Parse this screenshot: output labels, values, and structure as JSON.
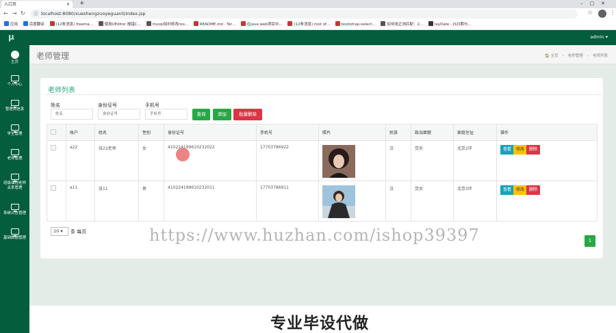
{
  "browser": {
    "tab_title": "入口页",
    "url": "localhost:8080/xueshengzuoyeguanli/index.jsp",
    "bookmarks": [
      "应用",
      "百度翻译",
      "(12条消息) freema...",
      "使用UEditor 报错C...",
      "mysql如何修改roo...",
      "README.md · Ter...",
      "在java web项目中...",
      "(12条消息) root of...",
      "bootstrap-select...",
      "如何用正则匹配：2...",
      "layDate - JS日期与..."
    ]
  },
  "app": {
    "logo": "μ",
    "user": "admin ▾",
    "sidebar": [
      {
        "label": "主页",
        "icon": "dashboard-icon"
      },
      {
        "label": "个人中心",
        "icon": "monitor-icon"
      },
      {
        "label": "管理员信息",
        "icon": "monitor-icon"
      },
      {
        "label": "学生管理",
        "icon": "monitor-icon"
      },
      {
        "label": "老师管理",
        "icon": "monitor-icon"
      },
      {
        "label": "班级课程老师",
        "label2": "关系管理",
        "icon": "monitor-icon"
      },
      {
        "label": "系统公告管理",
        "icon": "monitor-icon"
      },
      {
        "label": "基础数据管理",
        "icon": "monitor-icon"
      }
    ],
    "page_title": "老师管理",
    "breadcrumb": [
      "🏠 主页",
      "›",
      "老师管理",
      "›",
      "老师列表"
    ]
  },
  "card": {
    "title": "老师列表",
    "filters": [
      {
        "label": "姓名",
        "placeholder": "姓名"
      },
      {
        "label": "身份证号",
        "placeholder": "身份证号"
      },
      {
        "label": "手机号",
        "placeholder": "手机号"
      }
    ],
    "buttons": {
      "search": "查询",
      "add": "添加",
      "batch_delete": "批量删除"
    },
    "columns": [
      "",
      "账户",
      "姓名",
      "性别",
      "身份证号",
      "手机号",
      "照片",
      "民族",
      "政治面貌",
      "家庭住址",
      "操作"
    ],
    "rows": [
      {
        "account": "a22",
        "name": "张22老师",
        "gender": "女",
        "id_card": "410224199610232022",
        "phone": "17703786922",
        "ethnic": "汉",
        "politics": "党员",
        "address": "北京2环"
      },
      {
        "account": "a11",
        "name": "张11",
        "gender": "男",
        "id_card": "410224199610232011",
        "phone": "17703786911",
        "ethnic": "汉",
        "politics": "党员",
        "address": "北京3环"
      }
    ],
    "row_actions": {
      "view": "查看",
      "edit": "修改",
      "delete": "删除"
    },
    "page_size": "10 ▾",
    "page_size_label": "条 每页",
    "current_page": "1"
  },
  "overlay": {
    "watermark": "https://www.huzhan.com/ishop39397",
    "caption": "专业毕设代做"
  },
  "colors": {
    "theme": "#045d3d",
    "accent": "#28a745",
    "danger": "#dc3545",
    "info": "#17a2b8",
    "warning": "#ffc107"
  }
}
